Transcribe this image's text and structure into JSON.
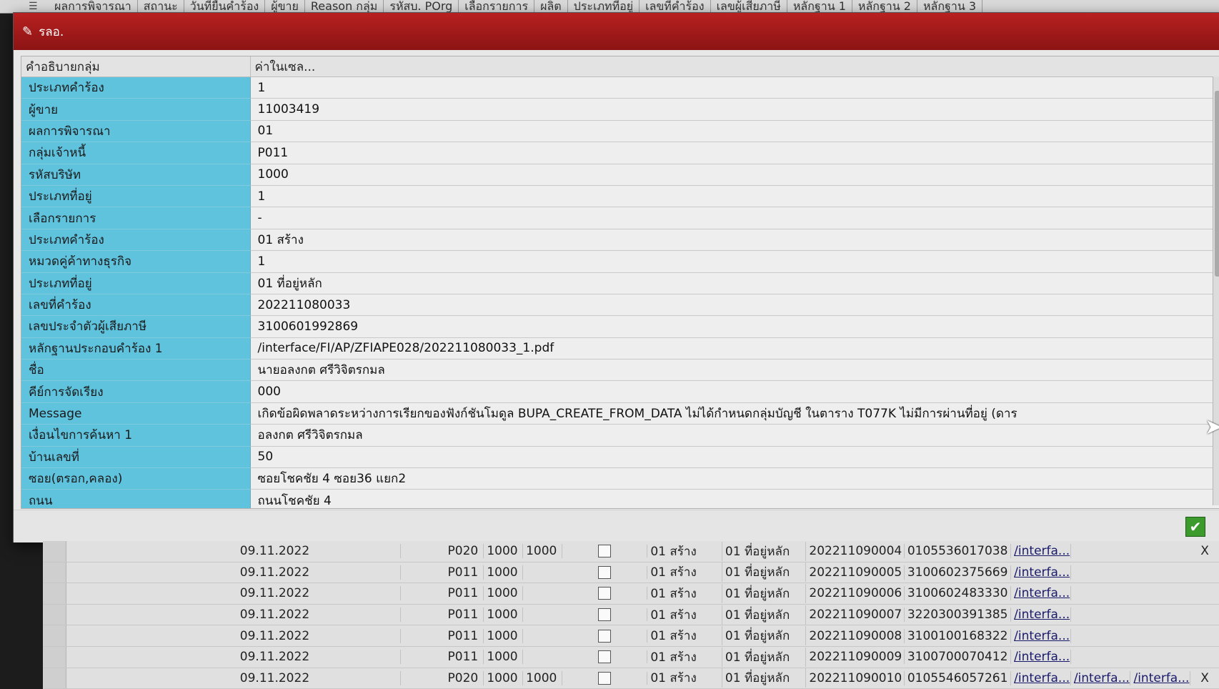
{
  "background_header": {
    "columns": [
      "ผลการพิจารณา",
      "สถานะ",
      "วันที่ยื่นคำร้อง",
      "ผู้ขาย",
      "Reason กลุ่ม",
      "รหัสบ. POrg",
      "เลือกรายการ",
      "ผลิต",
      "ประเภทที่อยู่",
      "เลขที่คำร้อง",
      "เลขผู้เสียภาษี",
      "หลักฐาน 1",
      "หลักฐาน 2",
      "หลักฐาน 3"
    ]
  },
  "dialog": {
    "title": "รลอ.",
    "header_col1": "คำอธิบายกลุ่ม",
    "header_col2": "ค่าในเซล...",
    "rows": [
      {
        "label": "ประเภทคำร้อง",
        "value": "1"
      },
      {
        "label": "ผู้ขาย",
        "value": "11003419"
      },
      {
        "label": "ผลการพิจารณา",
        "value": "01"
      },
      {
        "label": "กลุ่มเจ้าหนี้",
        "value": "P011"
      },
      {
        "label": "รหัสบริษัท",
        "value": "1000"
      },
      {
        "label": "ประเภทที่อยู่",
        "value": "1"
      },
      {
        "label": "เลือกรายการ",
        "value": "-"
      },
      {
        "label": "ประเภทคำร้อง",
        "value": "01 สร้าง"
      },
      {
        "label": "หมวดคู่ค้าทางธุรกิจ",
        "value": "1"
      },
      {
        "label": "ประเภทที่อยู่",
        "value": "01 ที่อยู่หลัก"
      },
      {
        "label": "เลขที่คำร้อง",
        "value": "202211080033"
      },
      {
        "label": "เลขประจำตัวผู้เสียภาษี",
        "value": "3100601992869"
      },
      {
        "label": "หลักฐานประกอบคำร้อง 1",
        "value": "/interface/FI/AP/ZFIAPE028/202211080033_1.pdf"
      },
      {
        "label": "ชื่อ",
        "value": "นายอลงกต ศรีวิจิตรกมล"
      },
      {
        "label": "คีย์การจัดเรียง",
        "value": "000"
      },
      {
        "label": "Message",
        "value": "เกิดข้อผิดพลาดระหว่างการเรียกของฟังก์ชันโมดูล BUPA_CREATE_FROM_DATA ไม่ได้กำหนดกลุ่มบัญชี ในตาราง T077K ไม่มีการผ่านที่อยู่ (ดาร"
      },
      {
        "label": "เงื่อนไขการค้นหา 1",
        "value": "อลงกต ศรีวิจิตรกมล"
      },
      {
        "label": "บ้านเลขที่",
        "value": "50"
      },
      {
        "label": "ซอย(ตรอก,คลอง)",
        "value": "ซอยโชคชัย 4 ซอย36 แยก2"
      },
      {
        "label": "ถนน",
        "value": "ถนนโชคชัย 4"
      }
    ],
    "ok_symbol": "✔"
  },
  "background_rows": [
    {
      "date": "09.11.2022",
      "group": "P020",
      "cc": "1000",
      "porg": "1000",
      "type": "01 สร้าง",
      "addr": "01 ที่อยู่หลัก",
      "req": "202211090004",
      "tax": "0105536017038",
      "link1": "/interfa...",
      "link2": "",
      "link3": "",
      "x": "X"
    },
    {
      "date": "09.11.2022",
      "group": "P011",
      "cc": "1000",
      "porg": "",
      "type": "01 สร้าง",
      "addr": "01 ที่อยู่หลัก",
      "req": "202211090005",
      "tax": "3100602375669",
      "link1": "/interfa...",
      "link2": "",
      "link3": "",
      "x": ""
    },
    {
      "date": "09.11.2022",
      "group": "P011",
      "cc": "1000",
      "porg": "",
      "type": "01 สร้าง",
      "addr": "01 ที่อยู่หลัก",
      "req": "202211090006",
      "tax": "3100602483330",
      "link1": "/interfa...",
      "link2": "",
      "link3": "",
      "x": ""
    },
    {
      "date": "09.11.2022",
      "group": "P011",
      "cc": "1000",
      "porg": "",
      "type": "01 สร้าง",
      "addr": "01 ที่อยู่หลัก",
      "req": "202211090007",
      "tax": "3220300391385",
      "link1": "/interfa...",
      "link2": "",
      "link3": "",
      "x": ""
    },
    {
      "date": "09.11.2022",
      "group": "P011",
      "cc": "1000",
      "porg": "",
      "type": "01 สร้าง",
      "addr": "01 ที่อยู่หลัก",
      "req": "202211090008",
      "tax": "3100100168322",
      "link1": "/interfa...",
      "link2": "",
      "link3": "",
      "x": ""
    },
    {
      "date": "09.11.2022",
      "group": "P011",
      "cc": "1000",
      "porg": "",
      "type": "01 สร้าง",
      "addr": "01 ที่อยู่หลัก",
      "req": "202211090009",
      "tax": "3100700070412",
      "link1": "/interfa...",
      "link2": "",
      "link3": "",
      "x": ""
    },
    {
      "date": "09.11.2022",
      "group": "P020",
      "cc": "1000",
      "porg": "1000",
      "type": "01 สร้าง",
      "addr": "01 ที่อยู่หลัก",
      "req": "202211090010",
      "tax": "0105546057261",
      "link1": "/interfa...",
      "link2": "/interfa...",
      "link3": "/interfa...",
      "x": "X"
    }
  ]
}
